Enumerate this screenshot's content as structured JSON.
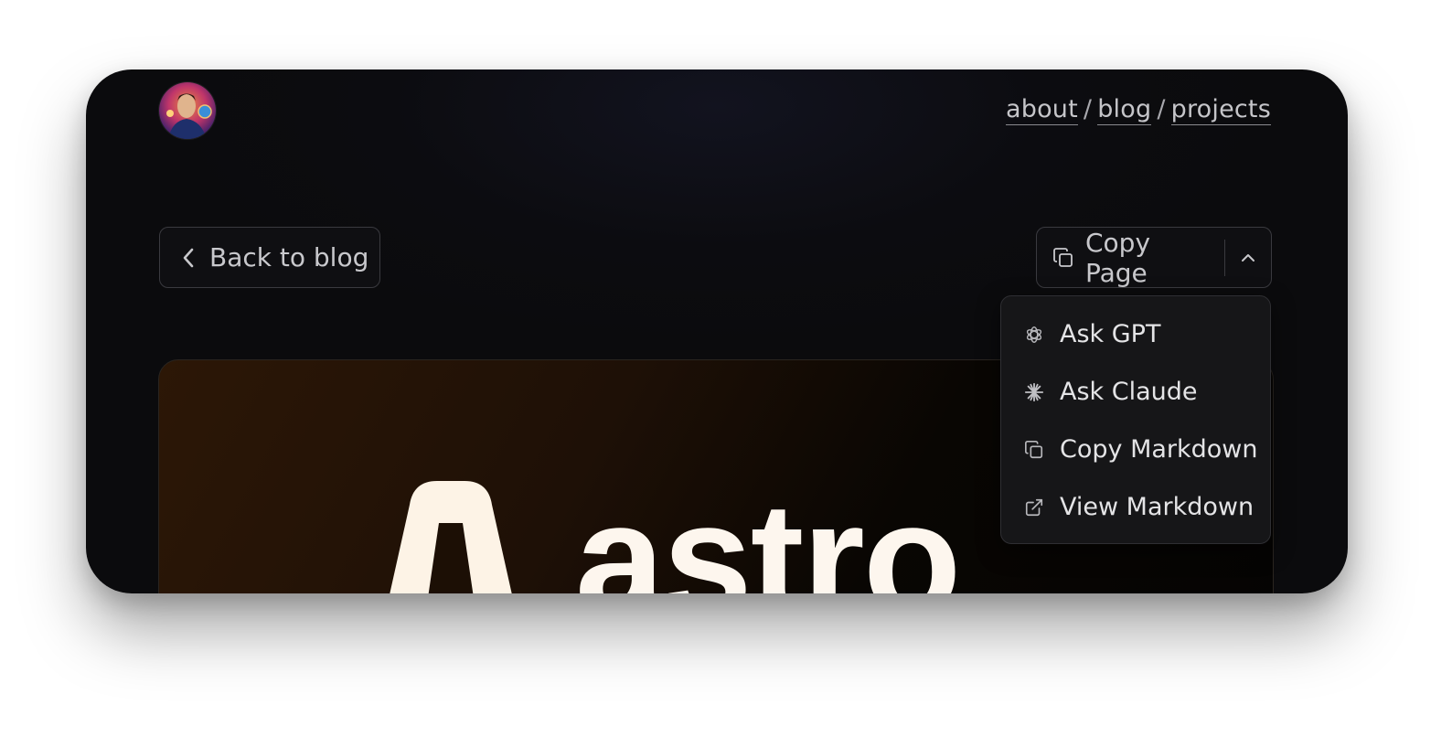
{
  "nav": {
    "links": [
      {
        "label": "about"
      },
      {
        "label": "blog"
      },
      {
        "label": "projects"
      }
    ],
    "separator": "/"
  },
  "actions": {
    "back_label": "Back to blog",
    "copy_label": "Copy Page"
  },
  "menu": {
    "items": [
      {
        "label": "Ask GPT",
        "icon": "openai-icon"
      },
      {
        "label": "Ask Claude",
        "icon": "claude-sparkle-icon"
      },
      {
        "label": "Copy Markdown",
        "icon": "copy-icon"
      },
      {
        "label": "View Markdown",
        "icon": "external-link-icon"
      }
    ]
  },
  "hero": {
    "word": "astro",
    "logo_letter": "A"
  },
  "colors": {
    "background": "#0b0b0d",
    "menu_bg": "#161618",
    "border": "#3a3a3f",
    "hero_text": "#fdf6ee"
  }
}
